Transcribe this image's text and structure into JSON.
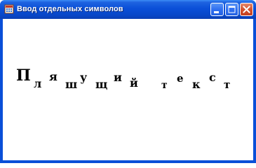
{
  "window": {
    "title": "Ввод отдельных символов",
    "icons": {
      "app": "application-icon",
      "minimize": "minimize-icon",
      "maximize": "maximize-icon",
      "close": "close-icon"
    },
    "colors": {
      "titlebar": "#0a4fd8",
      "close_button": "#d4522f",
      "client_background": "#ffffff"
    }
  },
  "canvas": {
    "glyphs": [
      "П",
      "л",
      "я",
      "ш",
      "у",
      "щ",
      "и",
      "й",
      "т",
      "е",
      "к",
      "с",
      "т"
    ]
  }
}
